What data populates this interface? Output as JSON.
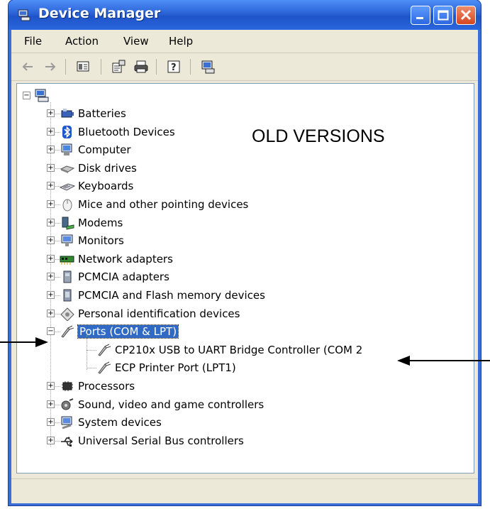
{
  "window": {
    "title": "Device Manager"
  },
  "menu": [
    "File",
    "Action",
    "View",
    "Help"
  ],
  "tree": {
    "items": [
      {
        "label": "Batteries",
        "icon": "battery-icon"
      },
      {
        "label": "Bluetooth Devices",
        "icon": "bluetooth-icon"
      },
      {
        "label": "Computer",
        "icon": "computer-icon"
      },
      {
        "label": "Disk drives",
        "icon": "disk-drive-icon"
      },
      {
        "label": "Keyboards",
        "icon": "keyboard-icon"
      },
      {
        "label": "Mice and other pointing devices",
        "icon": "mouse-icon"
      },
      {
        "label": "Modems",
        "icon": "modem-icon"
      },
      {
        "label": "Monitors",
        "icon": "monitor-icon"
      },
      {
        "label": "Network adapters",
        "icon": "network-adapter-icon"
      },
      {
        "label": "PCMCIA adapters",
        "icon": "pcmcia-icon"
      },
      {
        "label": "PCMCIA and Flash memory devices",
        "icon": "pcmcia-flash-icon"
      },
      {
        "label": "Personal identification devices",
        "icon": "identification-icon"
      },
      {
        "label": "Ports (COM & LPT)",
        "icon": "port-icon",
        "expanded": true,
        "children": [
          {
            "label": "CP210x USB to UART Bridge Controller (COM 2",
            "icon": "port-icon"
          },
          {
            "label": "ECP Printer Port (LPT1)",
            "icon": "port-icon"
          }
        ]
      },
      {
        "label": "Processors",
        "icon": "processor-icon"
      },
      {
        "label": "Sound, video and game controllers",
        "icon": "sound-icon"
      },
      {
        "label": "System devices",
        "icon": "system-devices-icon"
      },
      {
        "label": "Universal Serial Bus controllers",
        "icon": "usb-icon"
      }
    ]
  },
  "annotation": {
    "text": "OLD VERSIONS"
  },
  "colors": {
    "title_blue": "#2b63d6",
    "selection": "#316ac5",
    "face": "#ece9d8"
  }
}
